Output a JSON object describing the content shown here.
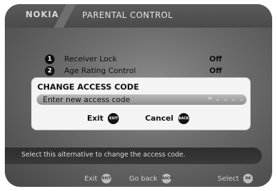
{
  "header": {
    "brand": "NOKIA",
    "title": "PARENTAL CONTROL"
  },
  "menu": [
    {
      "index": "1",
      "label": "Receiver Lock",
      "value": "Off"
    },
    {
      "index": "2",
      "label": "Age Rating Control",
      "value": "Off"
    }
  ],
  "dialog": {
    "title": "CHANGE ACCESS CODE",
    "field_label": "Enter new access code",
    "field_icon": "⌗",
    "field_value": "- - - -",
    "exit_label": "Exit",
    "exit_badge": "EXIT",
    "cancel_label": "Cancel",
    "cancel_badge": "BACK"
  },
  "help_text": "Select this alternative to change the access code.",
  "footer": {
    "exit_label": "Exit",
    "exit_badge": "EXIT",
    "back_label": "Go back",
    "back_badge": "BACK",
    "select_label": "Select",
    "select_badge": "OK"
  }
}
